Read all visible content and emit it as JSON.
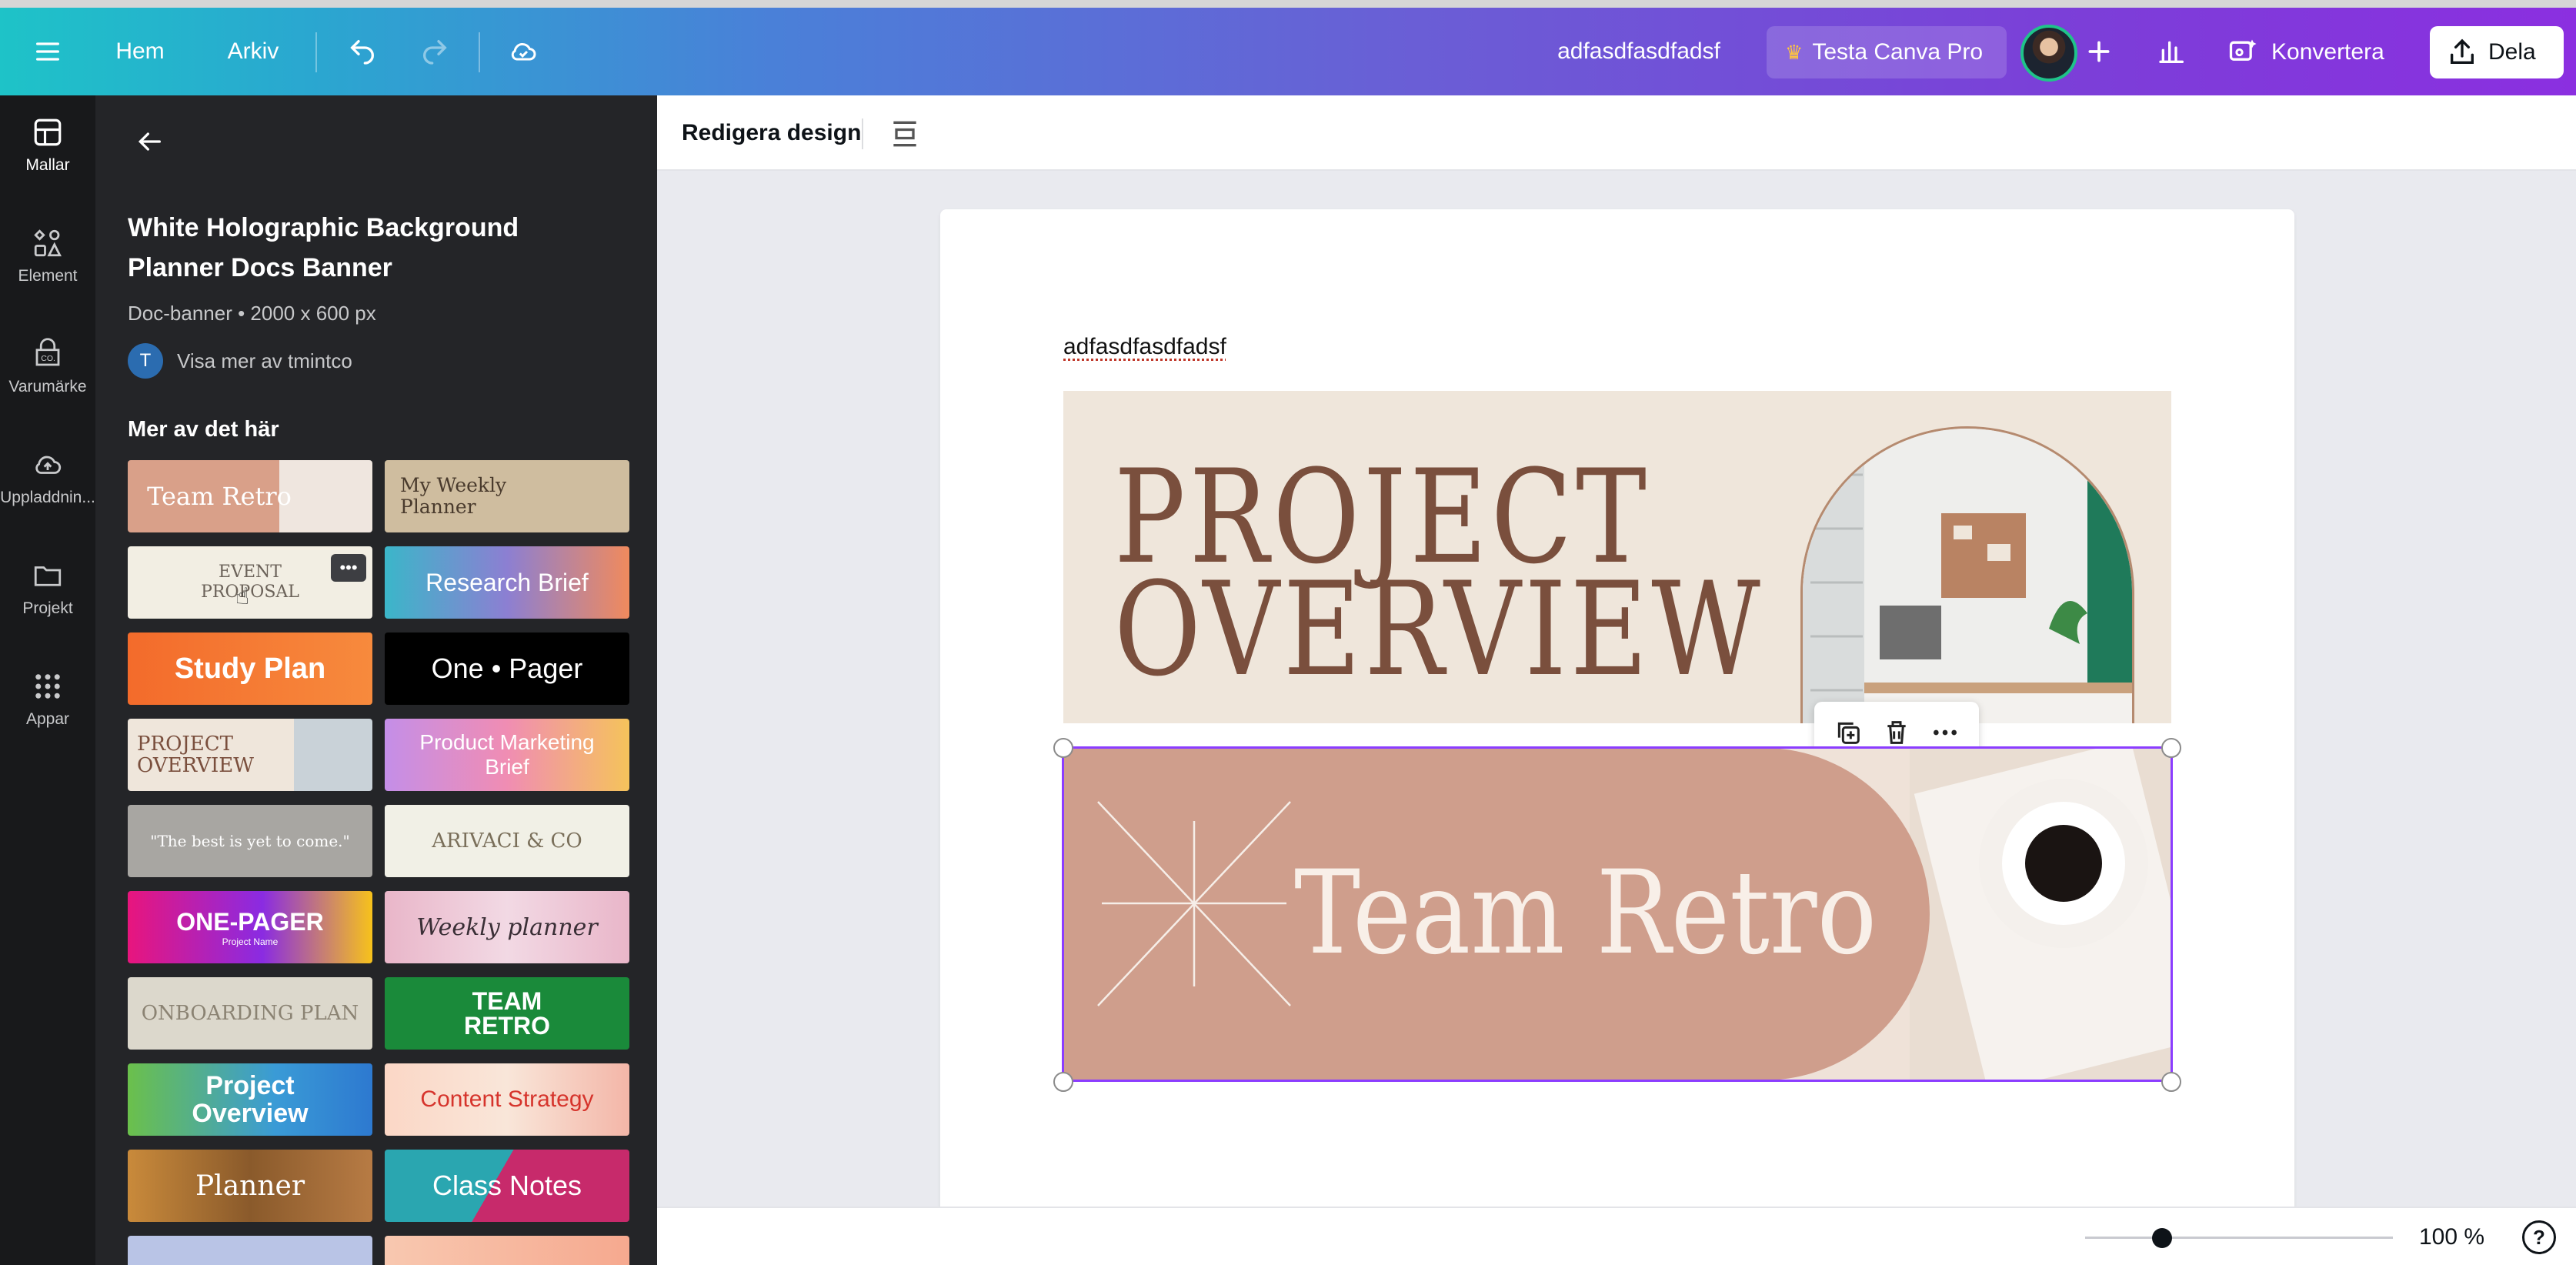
{
  "header": {
    "menu_icon": "hamburger-icon",
    "nav": [
      "Hem",
      "Arkiv"
    ],
    "doc_title": "adfasdfasdfadsf",
    "pro_label": "Testa Canva Pro",
    "convert_label": "Konvertera",
    "share_label": "Dela",
    "gradient": [
      "#1ec3c8",
      "#8b2fe0"
    ]
  },
  "rail": {
    "items": [
      "Mallar",
      "Element",
      "Varumärke",
      "Uppladdnin...",
      "Projekt",
      "Appar"
    ]
  },
  "panel": {
    "title": "White Holographic Background Planner Docs Banner",
    "meta": "Doc-banner • 2000 x 600 px",
    "author_initial": "T",
    "author_link": "Visa mer av tmintco",
    "section": "Mer av det här",
    "thumbnails": [
      {
        "text": "Team Retro"
      },
      {
        "text": "My Weekly Planner"
      },
      {
        "text": "EVENT PROPOSAL"
      },
      {
        "text": "Research Brief"
      },
      {
        "text": "Study Plan"
      },
      {
        "text": "One • Pager"
      },
      {
        "text": "PROJECT OVERVIEW"
      },
      {
        "text": "Product Marketing Brief"
      },
      {
        "text": "\"The best is yet to come.\""
      },
      {
        "text": "ARIVACI & CO"
      },
      {
        "text": "ONE-PAGER",
        "sub": "Project Name"
      },
      {
        "text": "Weekly planner"
      },
      {
        "text": "ONBOARDING PLAN"
      },
      {
        "text": "TEAM RETRO"
      },
      {
        "text": "Project Overview"
      },
      {
        "text": "Content Strategy"
      },
      {
        "text": "Planner"
      },
      {
        "text": "Class Notes"
      }
    ]
  },
  "editor": {
    "edit_design_label": "Redigera design",
    "doc_text": "adfasdfasdfadsf",
    "banner1": {
      "line1": "PROJECT",
      "line2": "OVERVIEW"
    },
    "banner2": {
      "text": "Team Retro"
    },
    "accent": "#8b3dff"
  },
  "footer": {
    "zoom": "100 %",
    "zoom_fraction": 0.25,
    "help": "?"
  }
}
